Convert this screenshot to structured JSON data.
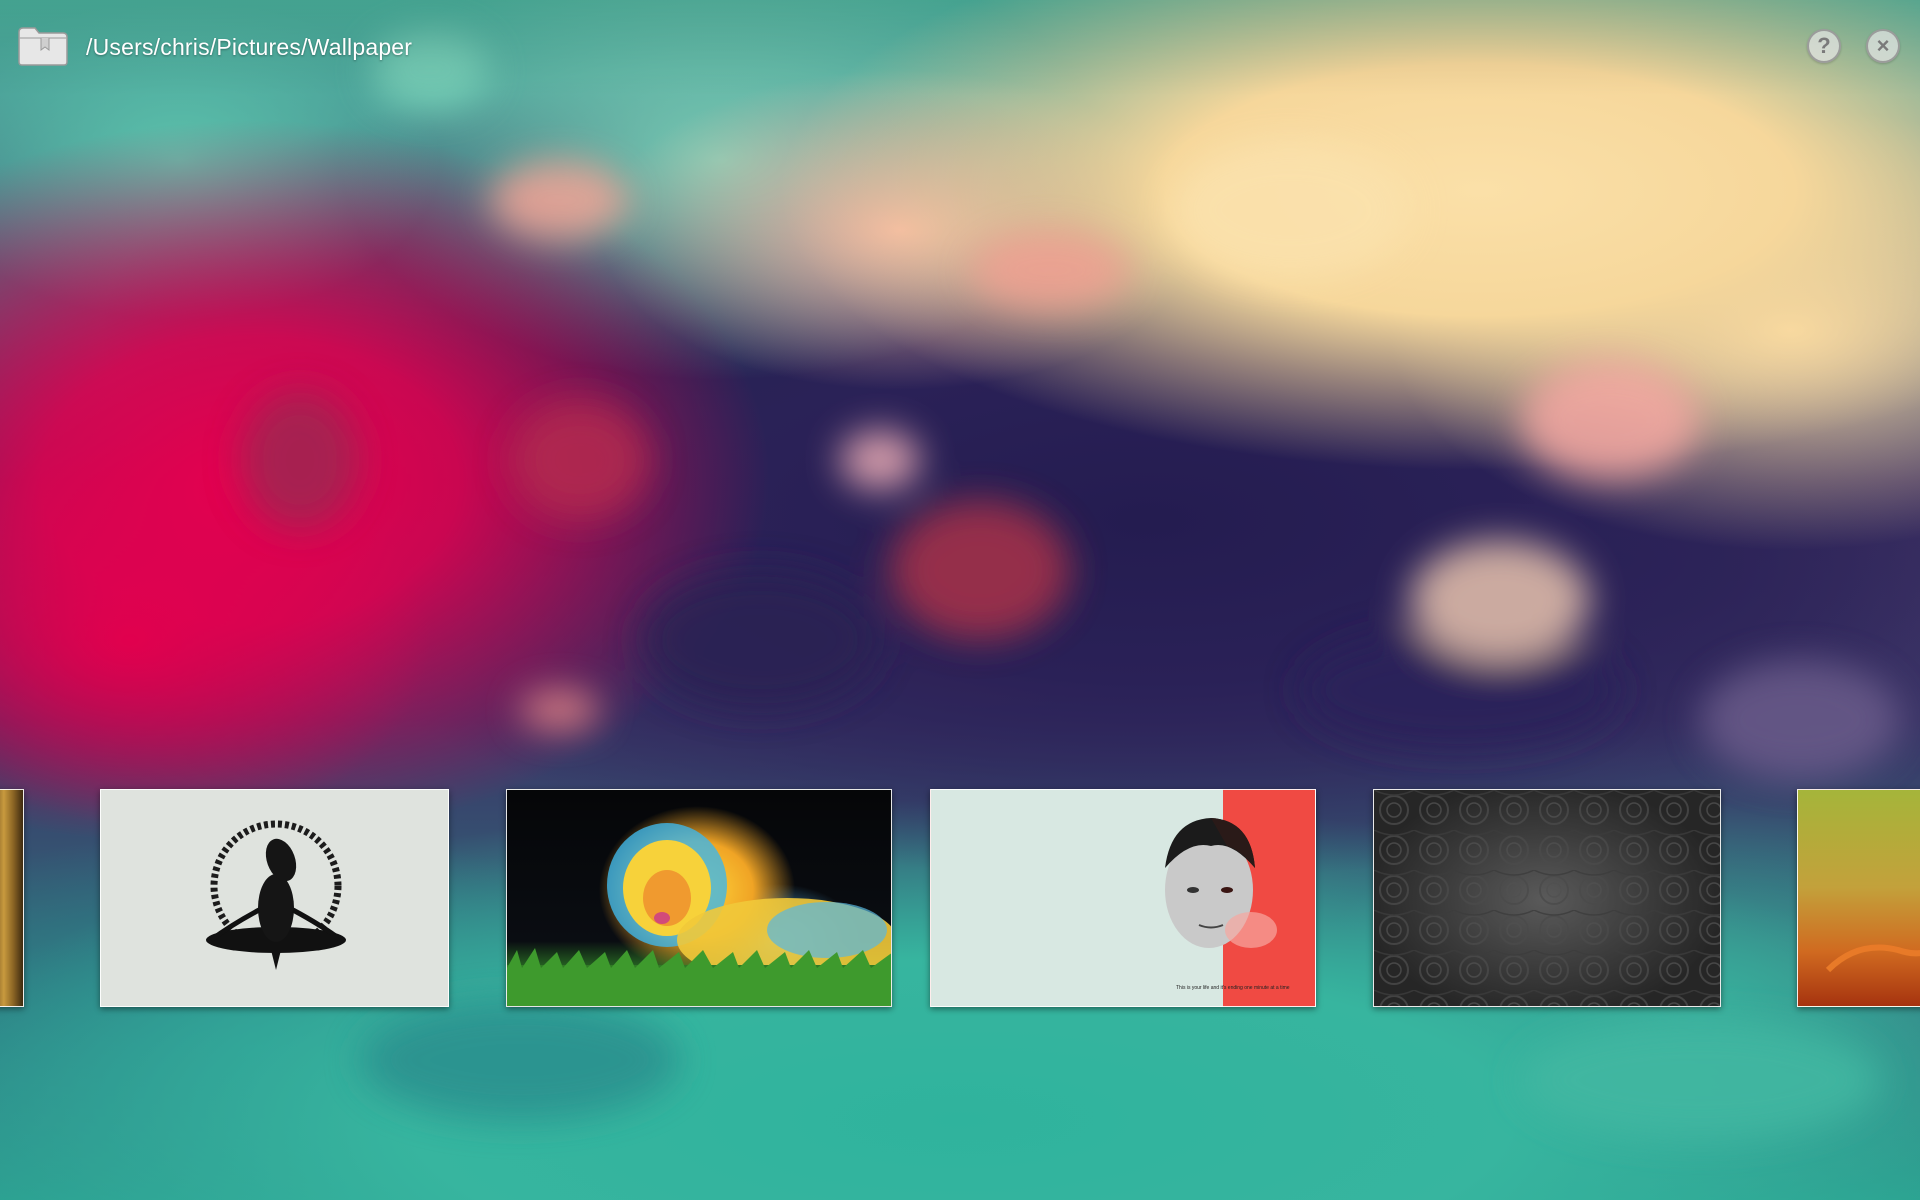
{
  "header": {
    "folder_icon": "folder-icon",
    "path": "/Users/chris/Pictures/Wallpaper",
    "help_icon": "question-mark-icon",
    "help_glyph": "?",
    "close_icon": "close-x-icon",
    "close_glyph": "×"
  },
  "thumbnails": [
    {
      "name": "golden-interior-wallpaper",
      "partial": true
    },
    {
      "name": "meditating-alien-wallpaper"
    },
    {
      "name": "neon-lion-wallpaper"
    },
    {
      "name": "split-face-wallpaper",
      "caption": "This is your life and it's ending one minute at a time"
    },
    {
      "name": "dark-paisley-pattern-wallpaper"
    },
    {
      "name": "orange-green-abstract-wallpaper",
      "partial": true
    }
  ],
  "colors": {
    "background_magenta": "#e5004f",
    "background_navy": "#241c50",
    "background_cream": "#fbe0a8",
    "background_teal": "#2fb39d",
    "button_gray": "#7a7a7a"
  }
}
